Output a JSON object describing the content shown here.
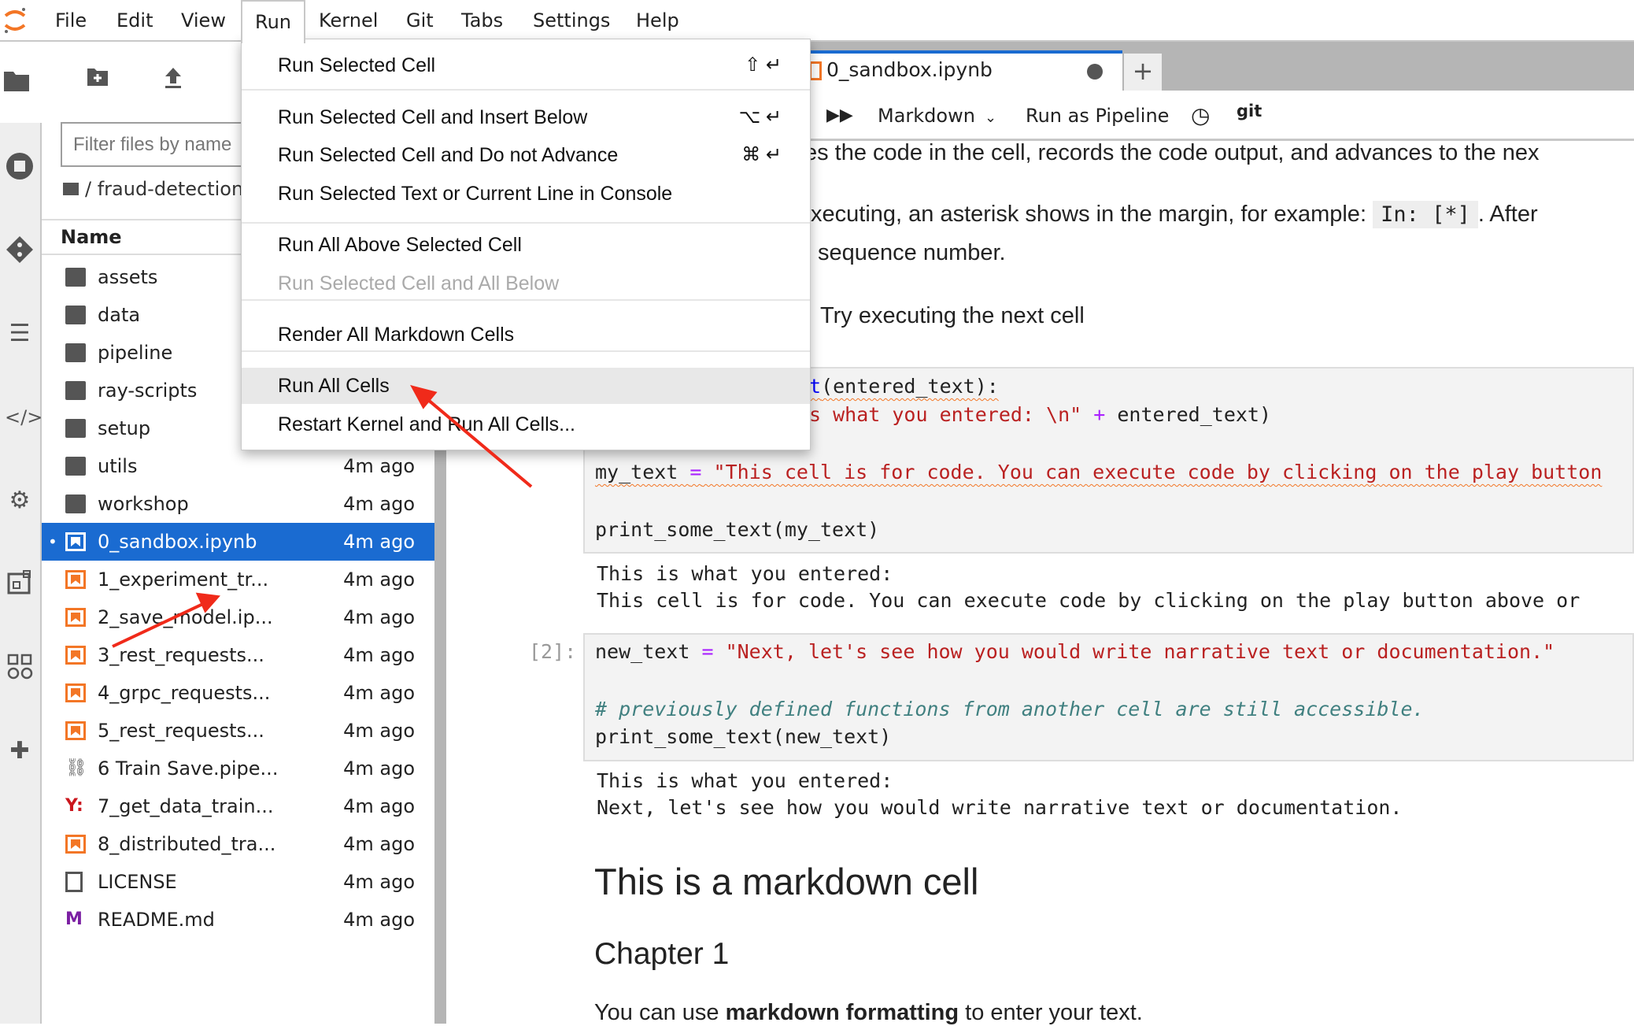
{
  "menubar": {
    "items": [
      "File",
      "Edit",
      "View",
      "Run",
      "Kernel",
      "Git",
      "Tabs",
      "Settings",
      "Help"
    ],
    "open": "Run"
  },
  "run_menu": {
    "items": [
      {
        "label": "Run Selected Cell",
        "shortcut": "⇧ ↵"
      },
      {
        "label": "Run Selected Cell and Insert Below",
        "shortcut": "⌥ ↵"
      },
      {
        "label": "Run Selected Cell and Do not Advance",
        "shortcut": "⌘ ↵"
      },
      {
        "label": "Run Selected Text or Current Line in Console",
        "shortcut": ""
      },
      {
        "label": "Run All Above Selected Cell",
        "shortcut": ""
      },
      {
        "label": "Run Selected Cell and All Below",
        "shortcut": "",
        "disabled": true
      },
      {
        "label": "Render All Markdown Cells",
        "shortcut": ""
      },
      {
        "label": "Run All Cells",
        "shortcut": "",
        "highlighted": true
      },
      {
        "label": "Restart Kernel and Run All Cells...",
        "shortcut": ""
      }
    ]
  },
  "browser": {
    "filter_placeholder": "Filter files by name",
    "breadcrumb": "/ fraud-detection",
    "name_header": "Name",
    "files": [
      {
        "name": "assets",
        "time": "",
        "type": "folder"
      },
      {
        "name": "data",
        "time": "",
        "type": "folder"
      },
      {
        "name": "pipeline",
        "time": "",
        "type": "folder"
      },
      {
        "name": "ray-scripts",
        "time": "",
        "type": "folder"
      },
      {
        "name": "setup",
        "time": "",
        "type": "folder"
      },
      {
        "name": "utils",
        "time": "4m ago",
        "type": "folder"
      },
      {
        "name": "workshop",
        "time": "4m ago",
        "type": "folder"
      },
      {
        "name": "0_sandbox.ipynb",
        "time": "4m ago",
        "type": "notebook",
        "selected": true
      },
      {
        "name": "1_experiment_tr...",
        "time": "4m ago",
        "type": "notebook"
      },
      {
        "name": "2_save_model.ip...",
        "time": "4m ago",
        "type": "notebook"
      },
      {
        "name": "3_rest_requests...",
        "time": "4m ago",
        "type": "notebook"
      },
      {
        "name": "4_grpc_requests...",
        "time": "4m ago",
        "type": "notebook"
      },
      {
        "name": "5_rest_requests...",
        "time": "4m ago",
        "type": "notebook"
      },
      {
        "name": "6 Train Save.pipe...",
        "time": "4m ago",
        "type": "pipeline"
      },
      {
        "name": "7_get_data_train...",
        "time": "4m ago",
        "type": "yaml"
      },
      {
        "name": "8_distributed_tra...",
        "time": "4m ago",
        "type": "notebook"
      },
      {
        "name": "LICENSE",
        "time": "4m ago",
        "type": "file"
      },
      {
        "name": "README.md",
        "time": "4m ago",
        "type": "markdown"
      }
    ]
  },
  "tab": {
    "title": "0_sandbox.ipynb",
    "plus": "+"
  },
  "toolbar": {
    "cell_type": "Markdown",
    "run_pipeline": "Run as Pipeline",
    "git": "git"
  },
  "notebook": {
    "md_line1": "es the code in the cell, records the code output, and advances to the nex",
    "md_line2a": "xecuting, an asterisk shows in the margin, for example: ",
    "md_line2_code": "In: [*]",
    "md_line2b": ". After",
    "md_line3": "sequence number.",
    "md_try": "Try executing the next cell",
    "cell1": {
      "l1_fn": "t",
      "l1_rest": "(entered_text):",
      "l2_str": "s what you entered: \\n\"",
      "l2_op": "+",
      "l2_rest": " entered_text)",
      "l3_var": "my_text ",
      "l3_op": "=",
      "l3_str": " \"This cell is for code. You can execute code by clicking on the play button",
      "l4": "print_some_text(my_text)"
    },
    "out1": [
      "This is what you entered:",
      "This cell is for code. You can execute code by clicking on the play button above or"
    ],
    "cell2": {
      "prompt": "[2]:",
      "l1_var": "new_text ",
      "l1_op": "=",
      "l1_str": " \"Next, let's see how you would write narrative text or documentation.\"",
      "l2": "# previously defined functions from another cell are still accessible.",
      "l3": "print_some_text(new_text)"
    },
    "out2": [
      "This is what you entered:",
      "Next, let's see how you would write narrative text or documentation."
    ],
    "h1": "This is a markdown cell",
    "h2": "Chapter 1",
    "p_a": "You can use ",
    "p_b": "markdown formatting",
    "p_c": " to enter your text."
  },
  "colors": {
    "accent": "#1a6bd1",
    "notebook_icon": "#f37626",
    "annotation_arrow": "#f02a1a"
  }
}
